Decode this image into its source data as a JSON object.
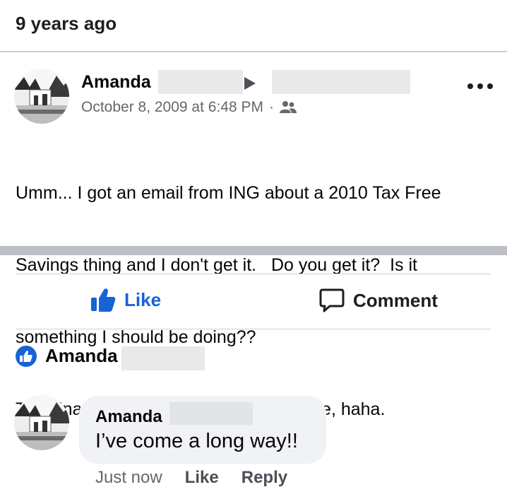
{
  "memory": {
    "label": "9 years ago"
  },
  "post": {
    "author": "Amanda",
    "timestamp": "October 8, 2009 at 6:48 PM",
    "separator": "·",
    "audience_icon": "friends-icon",
    "body_lines": [
      "Umm... I got an email from ING about a 2010 Tax Free",
      "Savings thing and I don't get it.   Do you get it?  Is it",
      "something I should be doing??",
      "This finance stuff is just too much for me, haha."
    ]
  },
  "actions": {
    "like_label": "Like",
    "comment_label": "Comment"
  },
  "reactions": {
    "liker_name": "Amanda"
  },
  "comment": {
    "author": "Amanda",
    "text": "I’ve come a long way!!",
    "time": "Just now",
    "like_label": "Like",
    "reply_label": "Reply"
  },
  "colors": {
    "accent": "#1763d6",
    "muted": "#65676b",
    "bubble": "#f0f2f5"
  }
}
